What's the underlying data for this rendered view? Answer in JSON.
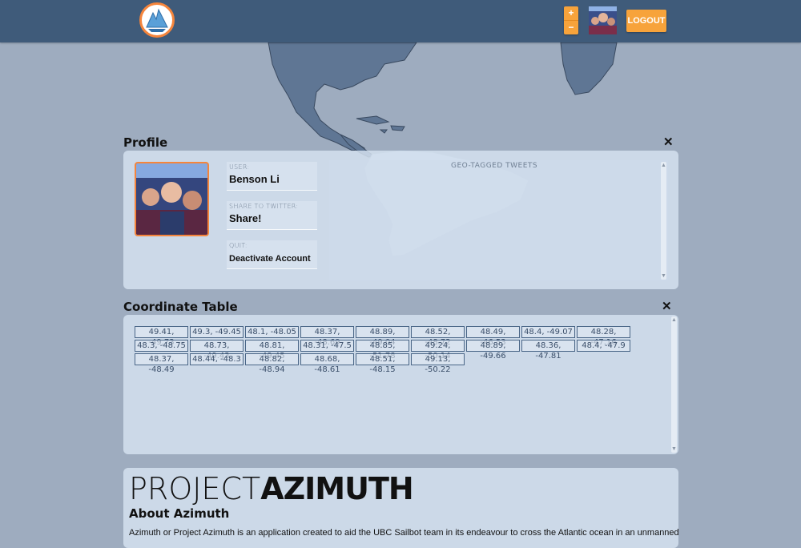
{
  "header": {
    "zoom_in": "+",
    "zoom_out": "−",
    "logout_label": "LOGOUT",
    "accent_color": "#f7a33b",
    "bar_color": "#3f5b7a"
  },
  "profile": {
    "title": "Profile",
    "close_glyph": "✕",
    "user_label": "USER:",
    "user_value": "Benson Li",
    "share_label": "SHARE TO TWITTER:",
    "share_value": "Share!",
    "quit_label": "QUIT:",
    "quit_value": "Deactivate Account",
    "tweets_label": "GEO-TAGGED TWEETS"
  },
  "coordinates": {
    "title": "Coordinate Table",
    "close_glyph": "✕",
    "items": [
      "49.41, -49.73",
      "49.3, -49.45",
      "48.1, -48.05",
      "48.37, -48.69",
      "48.89, -49.04",
      "48.52, -48.72",
      "48.49, -46.53",
      "48.4, -49.07",
      "48.28, -47.16",
      "48.3, -48.75",
      "48.73, -49.43",
      "48.81, -49.45",
      "48.31, -47.5",
      "48.85, -51.78",
      "49.24, -50.14",
      "48.89, -49.66",
      "48.36, -47.81",
      "48.4, -47.9",
      "48.37, -48.49",
      "48.44, -48.3",
      "48.82, -48.94",
      "48.68, -48.61",
      "48.51, -48.15",
      "49.13, -50.22"
    ]
  },
  "about": {
    "brand_thin": "PROJECT",
    "brand_bold": "AZIMUTH",
    "heading": "About Azimuth",
    "text": "Azimuth or Project Azimuth is an application created to aid the UBC Sailbot team in its endeavour to cross the Atlantic ocean in an unmanned"
  }
}
